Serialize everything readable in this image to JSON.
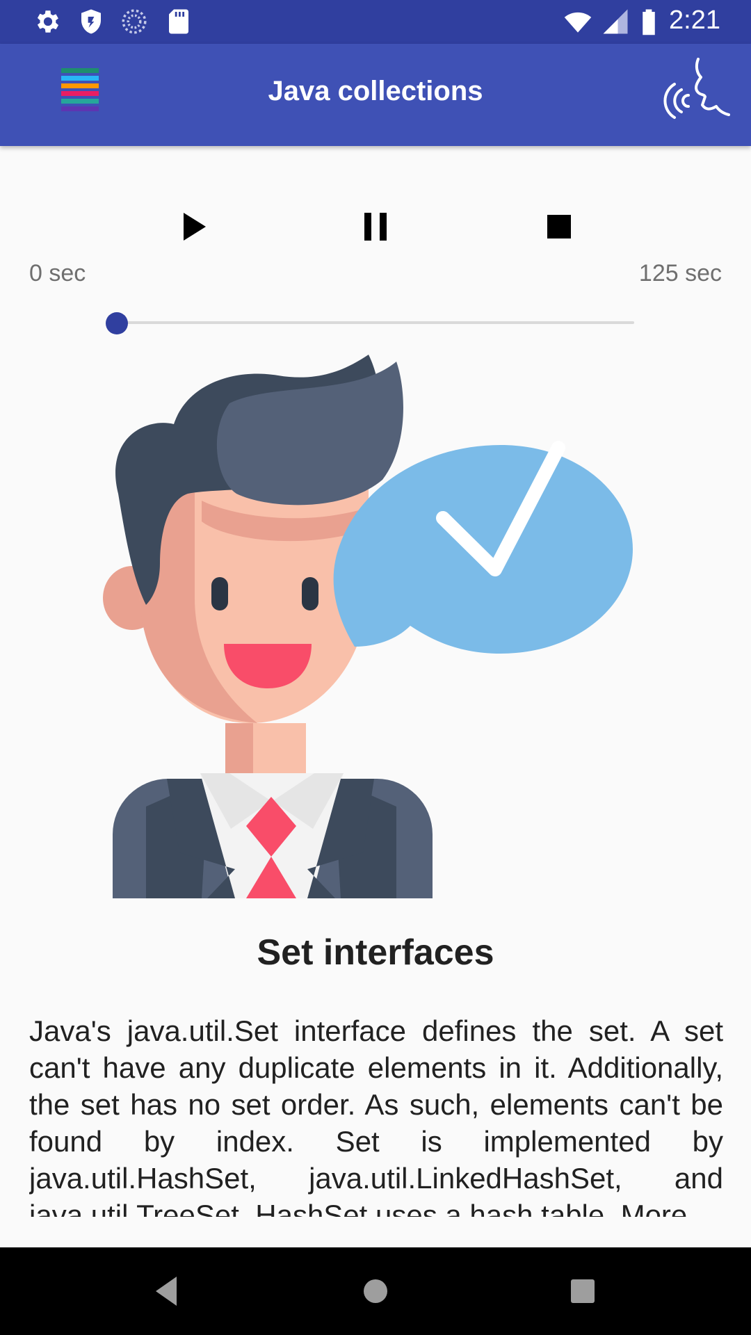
{
  "status_bar": {
    "time": "2:21",
    "left_icons": [
      "settings-icon",
      "shield-icon",
      "sync-icon",
      "sd-card-icon"
    ],
    "right_icons": [
      "wifi-icon",
      "cell-signal-icon",
      "battery-icon"
    ]
  },
  "app_bar": {
    "title": "Java collections",
    "menu_icon": "menu-icon",
    "action_icon": "speak-icon"
  },
  "player": {
    "start_label": "0 sec",
    "end_label": "125 sec",
    "progress": 0,
    "controls": [
      "play-icon",
      "pause-icon",
      "stop-icon"
    ],
    "accent_color": "#303f9f"
  },
  "content": {
    "heading": "Set interfaces",
    "body": "Java's java.util.Set interface defines the set. A set can't have any duplicate elements in it. Additionally, the set has no set order. As such, elements can't be found by index. Set is implemented by java.util.HashSet, java.util.LinkedHashSet, and java.util.TreeSet. HashSet uses a hash table. More"
  },
  "nav_bar": {
    "buttons": [
      "back-icon",
      "home-icon",
      "recents-icon"
    ]
  },
  "colors": {
    "status_bar": "#303f9f",
    "app_bar": "#3f51b5",
    "background": "#fafafa"
  }
}
